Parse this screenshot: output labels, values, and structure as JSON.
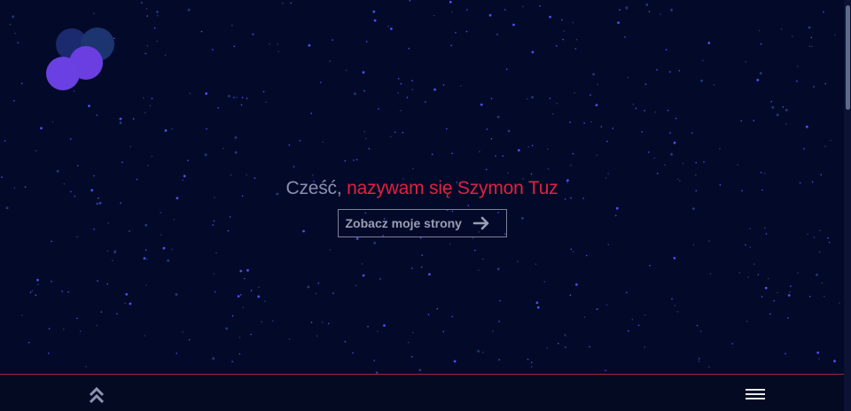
{
  "hero": {
    "greeting_prefix": "Cześć,",
    "greeting_name": "nazywam się Szymon Tuz",
    "cta_label": "Zobacz moje strony"
  },
  "icons": {
    "logo": "logo-circles-icon",
    "cta_arrow": "arrow-right-icon",
    "scroll_top": "double-chevron-up-icon",
    "menu": "hamburger-menu-icon"
  },
  "colors": {
    "background": "#030a29",
    "name_accent": "#e0213f",
    "greeting_text": "#8b8fb0",
    "star": "#4a4ff0",
    "footer_border": "#a6233f"
  }
}
